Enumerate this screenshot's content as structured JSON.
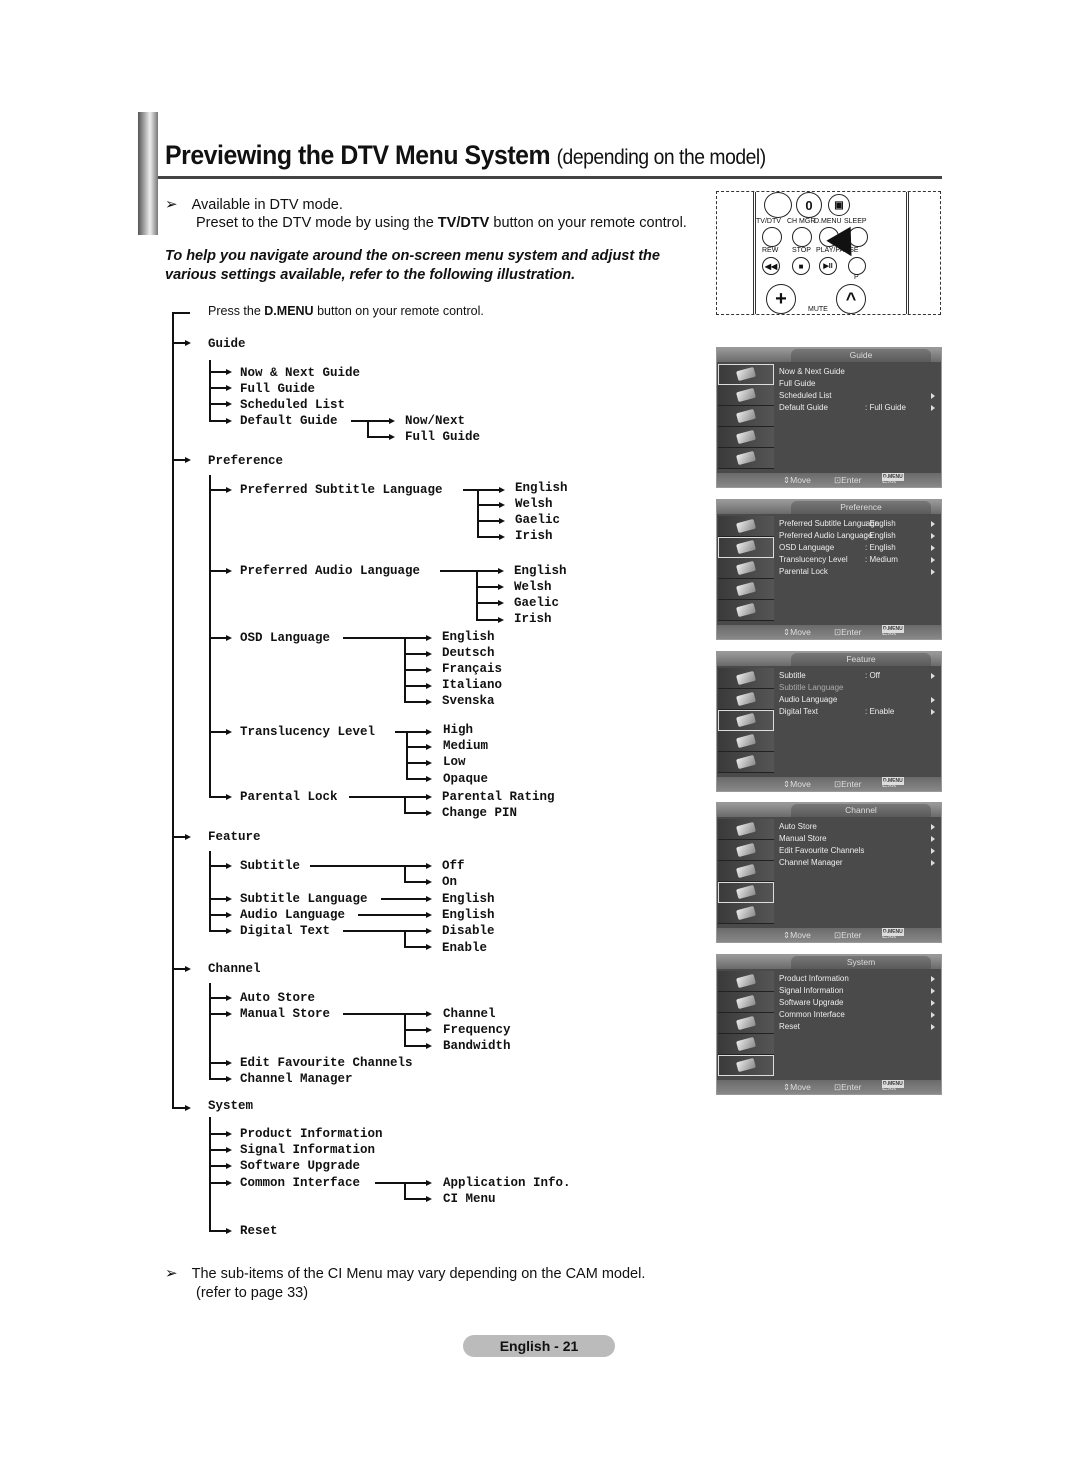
{
  "header": {
    "title": "Previewing the DTV Menu System",
    "title_suffix": "(depending on the model)"
  },
  "notes": {
    "arrow_glyph": "➢",
    "available": "Available in DTV mode.",
    "preset_prefix": "Preset to the DTV mode by using the ",
    "preset_bold": "TV/DTV",
    "preset_suffix": " button on your remote control.",
    "intro_line1": "To help you navigate around the on-screen menu system and adjust the",
    "intro_line2": "various settings available, refer to the following illustration.",
    "press_prefix": "Press the ",
    "press_bold": "D.MENU",
    "press_suffix": " button on your remote control."
  },
  "remote": {
    "zero": "0",
    "labels": [
      "TV/DTV",
      "CH MGR",
      "D.MENU",
      "SLEEP",
      "REW",
      "STOP",
      "PLAY/PAUSE",
      "P",
      "MUTE"
    ],
    "plus": "+",
    "caret": "^"
  },
  "tree": {
    "guide": "Guide",
    "guide_items": [
      "Now & Next Guide",
      "Full Guide",
      "Scheduled List",
      "Default Guide"
    ],
    "default_guide_opts": [
      "Now/Next",
      "Full Guide"
    ],
    "preference": "Preference",
    "pref_subtitle": "Preferred Subtitle Language",
    "pref_subtitle_opts": [
      "English",
      "Welsh",
      "Gaelic",
      "Irish"
    ],
    "pref_audio": "Preferred Audio Language",
    "pref_audio_opts": [
      "English",
      "Welsh",
      "Gaelic",
      "Irish"
    ],
    "osd": "OSD Language",
    "osd_opts": [
      "English",
      "Deutsch",
      "Français",
      "Italiano",
      "Svenska"
    ],
    "transl": "Translucency Level",
    "transl_opts": [
      "High",
      "Medium",
      "Low",
      "Opaque"
    ],
    "parental": "Parental Lock",
    "parental_opts": [
      "Parental Rating",
      "Change PIN"
    ],
    "feature": "Feature",
    "subtitle": "Subtitle",
    "subtitle_opts": [
      "Off",
      "On"
    ],
    "subtitle_lang": "Subtitle Language",
    "subtitle_lang_opt": "English",
    "audio_lang": "Audio Language",
    "audio_lang_opt": "English",
    "digital_text": "Digital Text",
    "digital_text_opts": [
      "Disable",
      "Enable"
    ],
    "channel": "Channel",
    "auto_store": "Auto Store",
    "manual_store": "Manual Store",
    "manual_store_opts": [
      "Channel",
      "Frequency",
      "Bandwidth"
    ],
    "edit_fav": "Edit Favourite Channels",
    "ch_manager": "Channel Manager",
    "system": "System",
    "sys_items": [
      "Product Information",
      "Signal Information",
      "Software Upgrade",
      "Common Interface"
    ],
    "ci_opts": [
      "Application Info.",
      "CI Menu"
    ],
    "reset": "Reset"
  },
  "tv_menus": [
    {
      "title": "Guide",
      "selected": 0,
      "rows": [
        {
          "label": "Now & Next Guide",
          "value": "",
          "arrow": false
        },
        {
          "label": "Full Guide",
          "value": "",
          "arrow": false
        },
        {
          "label": "Scheduled List",
          "value": "",
          "arrow": true
        },
        {
          "label": "Default Guide",
          "value": ": Full Guide",
          "arrow": true
        }
      ]
    },
    {
      "title": "Preference",
      "selected": 1,
      "rows": [
        {
          "label": "Preferred Subtitle Language",
          "value": ": English",
          "arrow": true
        },
        {
          "label": "Preferred Audio Language",
          "value": ": English",
          "arrow": true
        },
        {
          "label": "OSD Language",
          "value": ": English",
          "arrow": true
        },
        {
          "label": "Translucency Level",
          "value": ": Medium",
          "arrow": true
        },
        {
          "label": "Parental Lock",
          "value": "",
          "arrow": true
        }
      ]
    },
    {
      "title": "Feature",
      "selected": 2,
      "rows": [
        {
          "label": "Subtitle",
          "value": ": Off",
          "arrow": true
        },
        {
          "label": "Subtitle Language",
          "value": "",
          "arrow": false,
          "dim": true
        },
        {
          "label": "Audio Language",
          "value": "",
          "arrow": true
        },
        {
          "label": "Digital Text",
          "value": ": Enable",
          "arrow": true
        }
      ]
    },
    {
      "title": "Channel",
      "selected": 3,
      "rows": [
        {
          "label": "Auto Store",
          "value": "",
          "arrow": true
        },
        {
          "label": "Manual Store",
          "value": "",
          "arrow": true
        },
        {
          "label": "Edit Favourite Channels",
          "value": "",
          "arrow": true
        },
        {
          "label": "Channel Manager",
          "value": "",
          "arrow": true
        }
      ]
    },
    {
      "title": "System",
      "selected": 4,
      "rows": [
        {
          "label": "Product Information",
          "value": "",
          "arrow": true
        },
        {
          "label": "Signal Information",
          "value": "",
          "arrow": true
        },
        {
          "label": "Software Upgrade",
          "value": "",
          "arrow": true
        },
        {
          "label": "Common Interface",
          "value": "",
          "arrow": true
        },
        {
          "label": "Reset",
          "value": "",
          "arrow": true
        }
      ]
    }
  ],
  "tv_footer": {
    "move": "Move",
    "enter": "Enter",
    "dmenu": "D.MENU",
    "exit": "Exit"
  },
  "footnote": {
    "line1": "The sub-items of the CI Menu may vary depending on the CAM model.",
    "line2": "(refer to page 33)"
  },
  "page_number": "English - 21"
}
